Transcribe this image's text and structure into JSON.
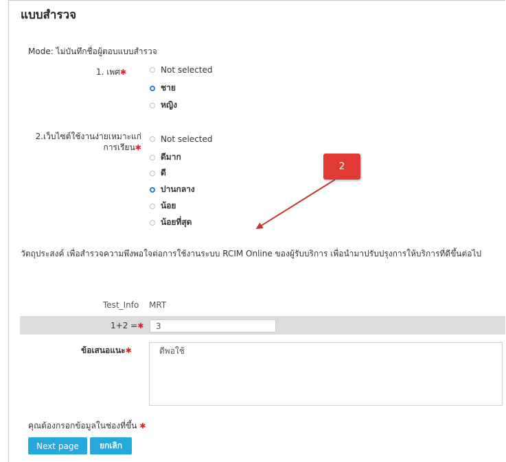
{
  "title": "แบบสำรวจ",
  "mode_text": "Mode: ไม่บันทึกชื่อผู้ตอบแบบสำรวจ",
  "q1": {
    "label": "1. เพศ",
    "options": [
      "Not selected",
      "ชาย",
      "หญิง"
    ],
    "selected_index": 1
  },
  "q2": {
    "label_line1": "2.เว็บไซต์ใช้งานง่ายเหมาะแก่",
    "label_line2": "การเรียน",
    "options": [
      "Not selected",
      "ดีมาก",
      "ดี",
      "ปานกลาง",
      "น้อย",
      "น้อยที่สุด"
    ],
    "selected_index": 3
  },
  "callout_label": "2",
  "description": "วัตถุประสงค์ เพื่อสำรวจความพึงพอใจต่อการใช้งานระบบ RCIM Online ของผู้รับบริการ เพื่อนำมาปรับปรุงการให้บริการที่ดีขึ้นต่อไป",
  "test_info": {
    "label": "Test_Info",
    "value": "MRT"
  },
  "captcha": {
    "label": "1+2 =",
    "value": "3"
  },
  "suggestion": {
    "label": "ข้อเสนอแนะ",
    "value": "ดีพอใช้"
  },
  "required_note": "คุณต้องกรอกข้อมูลในช่องที่ขึ้น",
  "buttons": {
    "next": "Next page",
    "cancel": "ยกเลิก"
  },
  "colors": {
    "accent": "#23a9dc",
    "required": "#e0202a",
    "callout": "#df3b34",
    "radio_selected": "#2a7ad6"
  }
}
